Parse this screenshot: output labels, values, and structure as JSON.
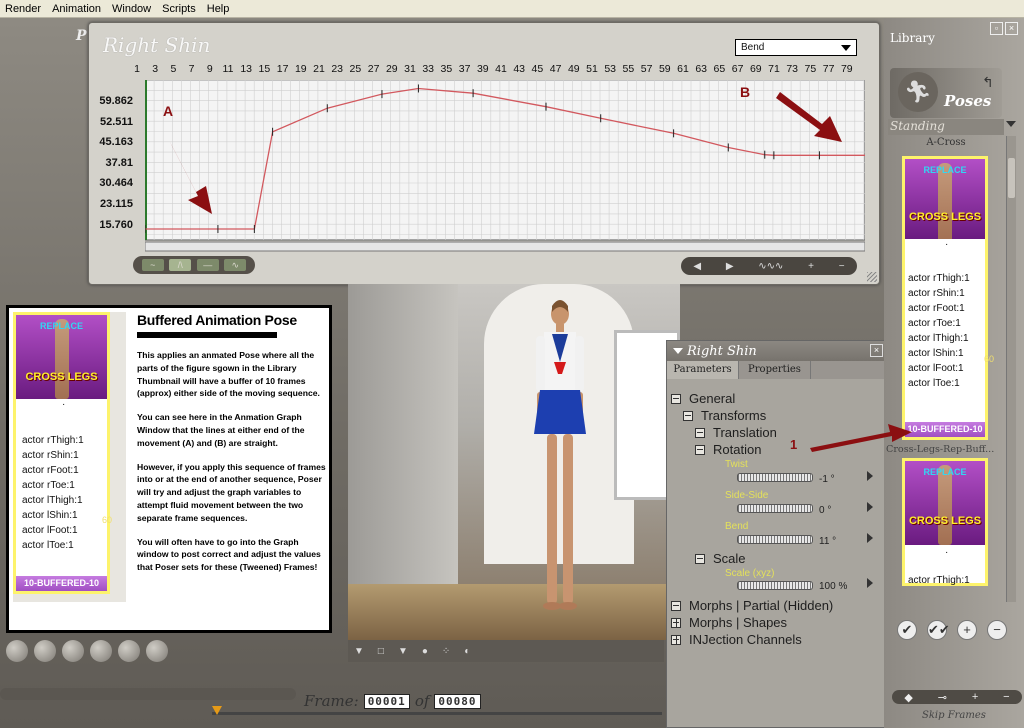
{
  "menubar": {
    "items": [
      "Render",
      "Animation",
      "Window",
      "Scripts",
      "Help"
    ]
  },
  "workspace": {
    "corner_label": "P"
  },
  "graph": {
    "title": "Right Shin",
    "dropdown_value": "Bend",
    "frame_ticks": [
      "1",
      "3",
      "5",
      "7",
      "9",
      "11",
      "13",
      "15",
      "17",
      "19",
      "21",
      "23",
      "25",
      "27",
      "29",
      "31",
      "33",
      "35",
      "37",
      "39",
      "41",
      "43",
      "45",
      "47",
      "49",
      "51",
      "53",
      "55",
      "57",
      "59",
      "61",
      "63",
      "65",
      "67",
      "69",
      "71",
      "73",
      "75",
      "77",
      "79"
    ],
    "y_labels": [
      "59.862",
      "52.511",
      "45.163",
      "37.81",
      "30.464",
      "23.115",
      "15.760"
    ],
    "annotation_a": "A",
    "annotation_b": "B",
    "chart_data": {
      "type": "line",
      "title": "Right Shin",
      "xlabel": "",
      "ylabel": "",
      "xlim": [
        1,
        80
      ],
      "ylim": [
        12,
        63
      ],
      "series": [
        {
          "name": "Bend",
          "x": [
            1,
            9,
            13,
            15,
            21,
            27,
            31,
            37,
            45,
            51,
            59,
            65,
            69,
            70,
            75,
            80
          ],
          "y": [
            15.5,
            15.5,
            15.5,
            46.5,
            54,
            58.5,
            60.3,
            58.8,
            54.5,
            50.8,
            46,
            41.5,
            39.2,
            39,
            39,
            39
          ]
        }
      ]
    },
    "controls_left": [
      "~",
      "/\\",
      "—",
      "∿"
    ],
    "controls_right": [
      "◀",
      "▶",
      "∿∿∿",
      "+",
      "−"
    ]
  },
  "tutorial": {
    "heading": "Buffered Animation Pose",
    "paragraphs": [
      "This applies an anmated Pose where all the parts of the figure sgown in the Library Thumbnail will have a buffer of 10 frames (approx) either side of the moving sequence.",
      "You can see here in the Anmation Graph Window that the lines at either end of the movement (A) and (B) are straight.",
      "However, if you apply this sequence of frames into or at the end of another sequence, Poser will try and adjust the graph variables to attempt fluid movement between the two separate frame sequences.",
      "You will often have to go into the Graph window to post correct and adjust the values that Poser sets for these (Tweened) Frames!"
    ],
    "thumb": {
      "replace": "REPLACE",
      "cross_legs": "CROSS LEGS",
      "dot": "·",
      "actors": [
        "actor rThigh:1",
        "actor rShin:1",
        "actor rFoot:1",
        "actor rToe:1",
        "actor lThigh:1",
        "actor lShin:1",
        "actor lFoot:1",
        "actor lToe:1"
      ],
      "number": "60",
      "label": "10-BUFFERED-10"
    }
  },
  "viewport": {
    "toolbar_icons": [
      "▼",
      "□",
      "▼",
      "●",
      "⁘",
      "◐"
    ]
  },
  "parameters": {
    "title": "Right Shin",
    "tabs": [
      "Parameters",
      "Properties"
    ],
    "tree": {
      "general": "General",
      "transforms": "Transforms",
      "translation": "Translation",
      "rotation": "Rotation",
      "scale_group": "Scale",
      "morphs_partial": "Morphs | Partial (Hidden)",
      "morphs_shapes": "Morphs | Shapes",
      "injection": "INJection Channels"
    },
    "dials": [
      {
        "label": "Twist",
        "value": "-1 °"
      },
      {
        "label": "Side-Side",
        "value": "0 °"
      },
      {
        "label": "Bend",
        "value": "11 °"
      },
      {
        "label": "Scale (xyz)",
        "value": "100 %"
      }
    ],
    "annotation_1": "1"
  },
  "library": {
    "title": "Library",
    "category": "Poses",
    "subcategory": "Standing",
    "first_item": "A-Cross",
    "item_number": "60",
    "item_label": "10-BUFFERED-10",
    "second_item_name": "Cross-Legs-Rep-Buff...",
    "second_item_actor": "actor rThigh:1",
    "actions": [
      "✔",
      "✔✔",
      "+",
      "−"
    ],
    "bottom_controls": [
      "◆",
      "⊸",
      "+",
      "−"
    ],
    "skip_frames": "Skip Frames"
  },
  "frames": {
    "label": "Frame:",
    "current": "00001",
    "of": "of",
    "total": "00080"
  },
  "colors": {
    "curve": "#d2585e",
    "annotation_arrow": "#8b0f11",
    "thumb_border": "#fdf36b"
  }
}
